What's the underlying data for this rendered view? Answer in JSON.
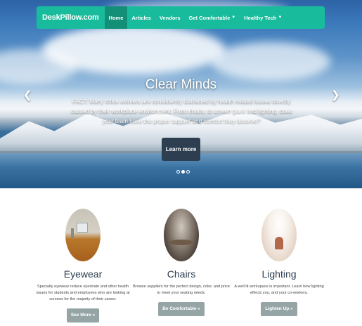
{
  "navbar": {
    "brand": "DeskPillow.com",
    "items": [
      {
        "label": "Home"
      },
      {
        "label": "Articles"
      },
      {
        "label": "Vendors"
      },
      {
        "label": "Get Comfortable"
      },
      {
        "label": "Healthy Tech"
      }
    ],
    "active": "Home",
    "color": "#18bc9c"
  },
  "carousel": {
    "title": "Clear Minds",
    "text": "FACT: Many office workers are consistently distracted by health related issues directly caused by their workplace environment. From chairs, to screen glare and lighting, does your team have the proper support and comfort they deserve?",
    "button_label": "Learn more",
    "slide_count": 3,
    "active_slide": 2
  },
  "features": [
    {
      "title": "Eyewear",
      "text": "Specialty eyewear reduce eyestrain and other health issues for students and employees who are looking at screens for the majority of their career.",
      "button_label": "See More »"
    },
    {
      "title": "Chairs",
      "text": "Browse suppliers for the perfect design, color, and price to meet your seating needs.",
      "button_label": "Be Comfortable »"
    },
    {
      "title": "Lighting",
      "text": "A well lit workspace is important. Learn how lighting effects you, and your co-workers.",
      "button_label": "Lighten Up »"
    }
  ]
}
